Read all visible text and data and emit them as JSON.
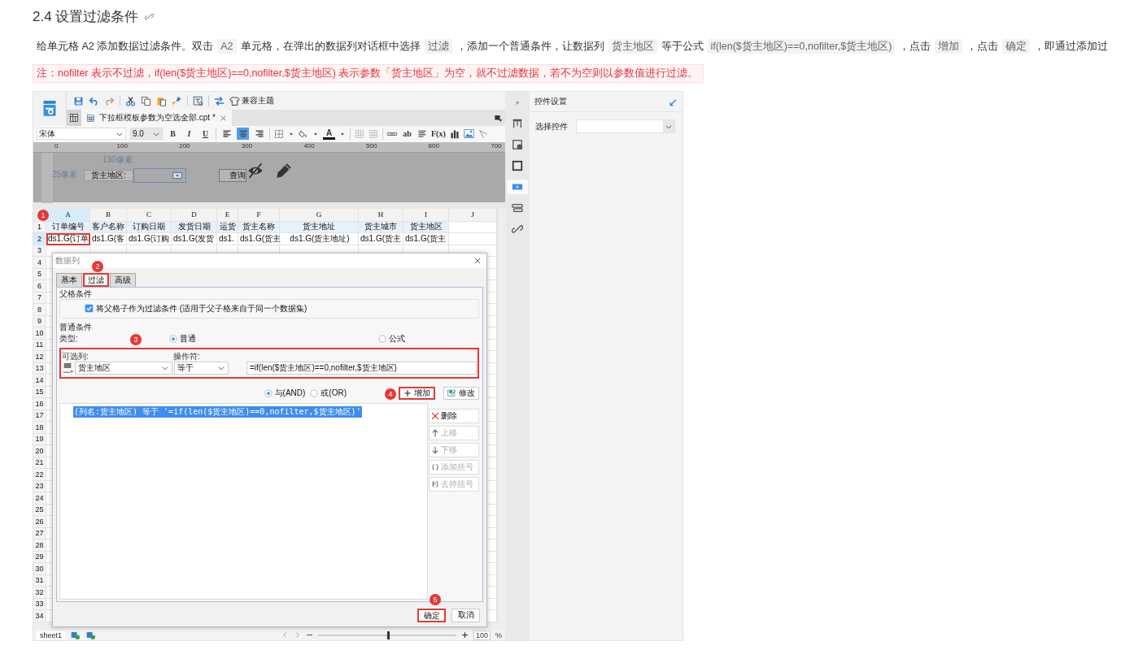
{
  "heading": {
    "number": "2.4",
    "title": "设置过滤条件"
  },
  "intro": [
    {
      "kind": "text",
      "text": "给单元格 A2 添加数据过滤条件。双击"
    },
    {
      "kind": "code",
      "text": "A2"
    },
    {
      "kind": "text",
      "text": "单元格，在弹出的数据列对话框中选择"
    },
    {
      "kind": "code",
      "text": "过滤"
    },
    {
      "kind": "text",
      "text": "，添加一个普通条件，让数据列"
    },
    {
      "kind": "code",
      "text": "货主地区"
    },
    {
      "kind": "text",
      "text": "等于公式"
    },
    {
      "kind": "code",
      "text": "if(len($货主地区)==0,nofilter,$货主地区)"
    },
    {
      "kind": "text",
      "text": "，点击"
    },
    {
      "kind": "code",
      "text": "增加"
    },
    {
      "kind": "text",
      "text": "，点击"
    },
    {
      "kind": "code",
      "text": "确定"
    },
    {
      "kind": "text",
      "text": "，即通过添加过"
    }
  ],
  "note": "注：nofilter 表示不过滤，if(len($货主地区)==0,nofilter,$货主地区) 表示参数「货主地区」为空，就不过滤数据，若不为空则以参数值进行过滤。",
  "app": {
    "toolbar": {
      "theme_button": "兼容主题"
    },
    "file_tab": {
      "title": "下拉框模板参数为空选全部.cpt *"
    },
    "format_bar": {
      "font": "宋体",
      "size": "9.0",
      "bold": "B",
      "italic": "I",
      "underline": "U",
      "font_color": "A",
      "text_tool": "ab",
      "formula_tool": "F(x)",
      "aligns": [
        {
          "kind": "left",
          "selected": false
        },
        {
          "kind": "center",
          "selected": true
        },
        {
          "kind": "right",
          "selected": false
        }
      ]
    },
    "ruler": [
      "0",
      "100",
      "200",
      "300",
      "400",
      "500",
      "600",
      "700"
    ],
    "param_pane": {
      "width_hint": "130像素",
      "height_hint": "25像素",
      "label": "货主地区:",
      "query_button": "查询"
    },
    "sheet": {
      "columns": [
        {
          "label": "A",
          "selected": true
        },
        {
          "label": "B",
          "selected": false
        },
        {
          "label": "C",
          "selected": false
        },
        {
          "label": "D",
          "selected": false
        },
        {
          "label": "E",
          "selected": false
        },
        {
          "label": "F",
          "selected": false
        },
        {
          "label": "G",
          "selected": false
        },
        {
          "label": "H",
          "selected": false
        },
        {
          "label": "I",
          "selected": false
        },
        {
          "label": "J",
          "selected": false
        }
      ],
      "header_row": [
        "订单编号",
        "客户名称",
        "订购日期",
        "发货日期",
        "运货",
        "货主名称",
        "货主地址",
        "货主城市",
        "货主地区"
      ],
      "data_row": [
        "ds1.G(订单",
        "ds1.G(客",
        "ds1.G(订购",
        "ds1.G(发货",
        "ds1.",
        "ds1.G(货主",
        "ds1.G(货主地址)",
        "ds1.G(货主",
        "ds1.G(货主"
      ],
      "rows": [
        {
          "label": "1",
          "selected": false
        },
        {
          "label": "2",
          "selected": true
        },
        {
          "label": "3",
          "selected": false
        },
        {
          "label": "4",
          "selected": false
        },
        {
          "label": "5",
          "selected": false
        },
        {
          "label": "6",
          "selected": false
        },
        {
          "label": "7",
          "selected": false
        },
        {
          "label": "8",
          "selected": false
        },
        {
          "label": "9",
          "selected": false
        },
        {
          "label": "10",
          "selected": false
        },
        {
          "label": "11",
          "selected": false
        },
        {
          "label": "12",
          "selected": false
        },
        {
          "label": "13",
          "selected": false
        },
        {
          "label": "14",
          "selected": false
        },
        {
          "label": "15",
          "selected": false
        },
        {
          "label": "16",
          "selected": false
        },
        {
          "label": "17",
          "selected": false
        },
        {
          "label": "18",
          "selected": false
        },
        {
          "label": "19",
          "selected": false
        },
        {
          "label": "20",
          "selected": false
        },
        {
          "label": "21",
          "selected": false
        },
        {
          "label": "22",
          "selected": false
        },
        {
          "label": "23",
          "selected": false
        },
        {
          "label": "24",
          "selected": false
        },
        {
          "label": "25",
          "selected": false
        },
        {
          "label": "26",
          "selected": false
        },
        {
          "label": "27",
          "selected": false
        },
        {
          "label": "28",
          "selected": false
        },
        {
          "label": "29",
          "selected": false
        },
        {
          "label": "30",
          "selected": false
        },
        {
          "label": "31",
          "selected": false
        },
        {
          "label": "32",
          "selected": false
        },
        {
          "label": "33",
          "selected": false
        },
        {
          "label": "34",
          "selected": false
        }
      ]
    },
    "dialog": {
      "title": "数据列",
      "tabs": [
        {
          "label": "基本",
          "selected": false
        },
        {
          "label": "过滤",
          "selected": true
        },
        {
          "label": "高级",
          "selected": false
        }
      ],
      "parent_group": {
        "title": "父格条件",
        "checkbox": {
          "label": "将父格子作为过滤条件 (适用于父子格来自于同一个数据集)",
          "checked": true
        }
      },
      "normal_group": {
        "title": "普通条件",
        "type_label": "类型:",
        "types": [
          {
            "label": "普通",
            "selected": true
          },
          {
            "label": "公式",
            "selected": false
          }
        ],
        "column_label": "可选列:",
        "column_value": "货主地区",
        "operator_label": "操作符:",
        "operator_value": "等于",
        "formula": "=if(len($货主地区)==0,nofilter,$货主地区)"
      },
      "joins": [
        {
          "label": "与(AND)",
          "selected": true
        },
        {
          "label": "或(OR)",
          "selected": false
        }
      ],
      "add_button": "增加",
      "edit_button": "修改",
      "conditions": [
        {
          "text": "(列名:货主地区) 等于 '=if(len($货主地区)==0,nofilter,$货主地区)'",
          "selected": true
        }
      ],
      "side_buttons": [
        {
          "kind": "delete",
          "label": "删除",
          "disabled": false
        },
        {
          "kind": "up",
          "label": "上移",
          "disabled": true
        },
        {
          "kind": "down",
          "label": "下移",
          "disabled": true
        },
        {
          "kind": "add_bracket",
          "label": "添加括号",
          "disabled": true
        },
        {
          "kind": "remove_bracket",
          "label": "去掉括号",
          "disabled": true
        }
      ],
      "ok_button": "确定",
      "cancel_button": "取消"
    },
    "steps": [
      "1",
      "2",
      "3",
      "4",
      "5"
    ],
    "status_bar": {
      "sheet_tab": "sheet1",
      "zoom": {
        "level": 0.5,
        "value": "100",
        "percent": "%"
      }
    },
    "right_panel": {
      "title": "控件设置",
      "select_label": "选择控件"
    }
  }
}
